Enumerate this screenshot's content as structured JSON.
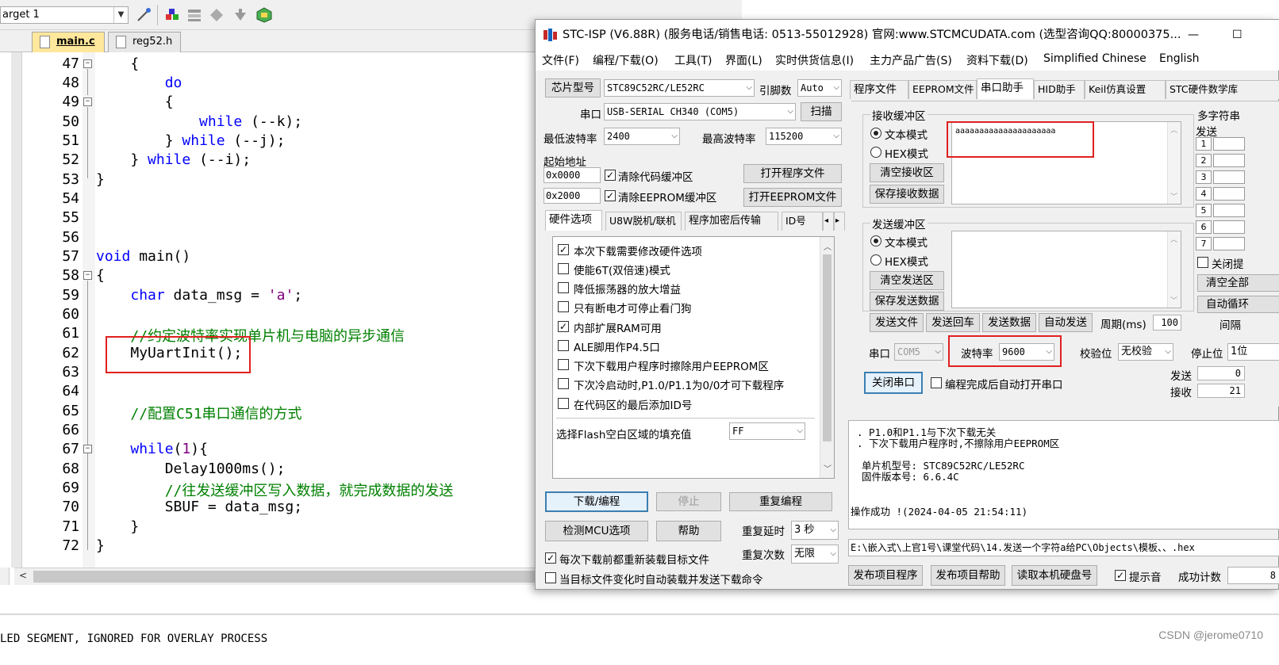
{
  "keil": {
    "target": "arget 1",
    "tabs": [
      "main.c",
      "reg52.h"
    ],
    "lines": [
      {
        "n": "47",
        "code": "    {"
      },
      {
        "n": "48",
        "code": "        do"
      },
      {
        "n": "49",
        "code": "        {"
      },
      {
        "n": "50",
        "code": "            while (--k);"
      },
      {
        "n": "51",
        "code": "        } while (--j);"
      },
      {
        "n": "52",
        "code": "    } while (--i);"
      },
      {
        "n": "53",
        "code": "}"
      },
      {
        "n": "54",
        "code": ""
      },
      {
        "n": "55",
        "code": ""
      },
      {
        "n": "56",
        "code": ""
      },
      {
        "n": "57",
        "code": "void main()"
      },
      {
        "n": "58",
        "code": "{"
      },
      {
        "n": "59",
        "code": "    char data_msg = 'a';"
      },
      {
        "n": "60",
        "code": ""
      },
      {
        "n": "61",
        "code": "    //约定波特率实现单片机与电脑的异步通信"
      },
      {
        "n": "62",
        "code": "    MyUartInit();"
      },
      {
        "n": "63",
        "code": ""
      },
      {
        "n": "64",
        "code": ""
      },
      {
        "n": "65",
        "code": "    //配置C51串口通信的方式"
      },
      {
        "n": "66",
        "code": ""
      },
      {
        "n": "67",
        "code": "    while(1){"
      },
      {
        "n": "68",
        "code": "        Delay1000ms();"
      },
      {
        "n": "69",
        "code": "        //往发送缓冲区写入数据，就完成数据的发送"
      },
      {
        "n": "70",
        "code": "        SBUF = data_msg;"
      },
      {
        "n": "71",
        "code": "    }"
      },
      {
        "n": "72",
        "code": "}"
      }
    ],
    "code_tokens": {
      "do": "do",
      "while": "while",
      "void": "void",
      "char": "char",
      "k_tail": " (--k);",
      "j_tail": " (--j);",
      "i_tail": " (--i);",
      "close_brace": "} ",
      "main_decl": " main()",
      "data_decl": " data_msg = ",
      "char_lit": "'a'",
      "semi": ";",
      "comment_61": "//约定波特率实现单片机与电脑的异步通信",
      "init_call": "MyUartInit();",
      "comment_65": "//配置C51串口通信的方式",
      "while1_open": "(",
      "while1_num": "1",
      "while1_close": "){",
      "delay_call": "Delay1000ms();",
      "comment_69": "//往发送缓冲区写入数据，就完成数据的发送",
      "sbuf_line": "SBUF = data_msg;"
    },
    "build_output": "LED SEGMENT, IGNORED FOR OVERLAY PROCESS"
  },
  "stc": {
    "title": "STC-ISP (V6.88R) (服务电话/销售电话: 0513-55012928) 官网:www.STCMCUDATA.com  (选型咨询QQ:80000375...",
    "minimize": "—",
    "maximize": "☐",
    "menu": [
      "文件(F)",
      "编程/下载(O)",
      "工具(T)",
      "界面(L)",
      "实时供货信息(I)",
      "主力产品广告(S)",
      "资料下载(D)",
      "Simplified Chinese",
      "English"
    ],
    "left": {
      "chip_label": "芯片型号",
      "chip_value": "STC89C52RC/LE52RC",
      "pin_label": "引脚数",
      "pin_value": "Auto",
      "port_label": "串口",
      "port_value": "USB-SERIAL CH340 (COM5)",
      "scan_btn": "扫描",
      "min_baud_label": "最低波特率",
      "min_baud_value": "2400",
      "max_baud_label": "最高波特率",
      "max_baud_value": "115200",
      "start_addr_label": "起始地址",
      "addr1": "0x0000",
      "addr2": "0x2000",
      "clear_code": "清除代码缓冲区",
      "clear_eeprom": "清除EEPROM缓冲区",
      "open_prog": "打开程序文件",
      "open_eeprom": "打开EEPROM文件",
      "subtabs": [
        "硬件选项",
        "U8W脱机/联机",
        "程序加密后传输",
        "ID号"
      ],
      "options": [
        {
          "label": "本次下载需要修改硬件选项",
          "checked": true
        },
        {
          "label": "使能6T(双倍速)模式",
          "checked": false
        },
        {
          "label": "降低振荡器的放大增益",
          "checked": false
        },
        {
          "label": "只有断电才可停止看门狗",
          "checked": false
        },
        {
          "label": "内部扩展RAM可用",
          "checked": true
        },
        {
          "label": "ALE脚用作P4.5口",
          "checked": false
        },
        {
          "label": "下次下载用户程序时擦除用户EEPROM区",
          "checked": false
        },
        {
          "label": "下次冷启动时,P1.0/P1.1为0/0才可下载程序",
          "checked": false
        },
        {
          "label": "在代码区的最后添加ID号",
          "checked": false
        }
      ],
      "fill_label": "选择Flash空白区域的填充值",
      "fill_value": "FF",
      "download_btn": "下载/编程",
      "stop_btn": "停止",
      "reprog_btn": "重复编程",
      "detect_btn": "检测MCU选项",
      "help_btn": "帮助",
      "repeat_delay_label": "重复延时",
      "repeat_delay_value": "3 秒",
      "repeat_count_label": "重复次数",
      "repeat_count_value": "无限",
      "reload_label": "每次下载前都重新装载目标文件",
      "autoload_label": "当目标文件变化时自动装载并发送下载命令"
    },
    "right": {
      "tabs": [
        "程序文件",
        "EEPROM文件",
        "串口助手",
        "HID助手",
        "Keil仿真设置",
        "STC硬件数学库"
      ],
      "recv_group": "接收缓冲区",
      "text_mode": "文本模式",
      "hex_mode": "HEX模式",
      "clear_recv": "清空接收区",
      "save_recv": "保存接收数据",
      "recv_content": "aaaaaaaaaaaaaaaaaaaaa",
      "send_group": "发送缓冲区",
      "clear_send": "清空发送区",
      "save_send": "保存发送数据",
      "send_file": "发送文件",
      "send_enter": "发送回车",
      "send_data": "发送数据",
      "auto_send": "自动发送",
      "period_label": "周期(ms)",
      "period_value": "100",
      "port_label": "串口",
      "port_value": "COM5",
      "baud_label": "波特率",
      "baud_value": "9600",
      "parity_label": "校验位",
      "parity_value": "无校验",
      "stop_label": "停止位",
      "stop_value": "1位",
      "close_port_btn": "关闭串口",
      "auto_open_label": "编程完成后自动打开串口",
      "sent_label": "发送",
      "sent_value": "0",
      "recv_label": "接收",
      "recv_value": "21",
      "multi_title": "多字符串",
      "multi_send": "发送",
      "multi_nums": [
        "1",
        "2",
        "3",
        "4",
        "5",
        "6",
        "7"
      ],
      "close_hint": "关闭提",
      "clear_all": "清空全部",
      "auto_loop": "自动循环",
      "interval": "间隔"
    },
    "log": {
      "line1": ". P1.0和P1.1与下次下载无关",
      "line2": ". 下次下载用户程序时,不擦除用户EEPROM区",
      "line3": "单片机型号: STC89C52RC/LE52RC",
      "line4": "固件版本号: 6.6.4C",
      "line5": "操作成功 !(2024-04-05 21:54:11)"
    },
    "path": "E:\\嵌入式\\上官1号\\课堂代码\\14.发送一个字符a给PC\\Objects\\模板、、.hex",
    "bottom": {
      "publish_prog": "发布项目程序",
      "publish_help": "发布项目帮助",
      "read_disk": "读取本机硬盘号",
      "beep_label": "提示音",
      "success_label": "成功计数",
      "success_value": "8"
    }
  },
  "watermark": "CSDN @jerome0710",
  "colors": {
    "highlight_red": "#e02020",
    "keyword_blue": "#0000ff",
    "comment_green": "#008000",
    "string_purple": "#800080"
  }
}
